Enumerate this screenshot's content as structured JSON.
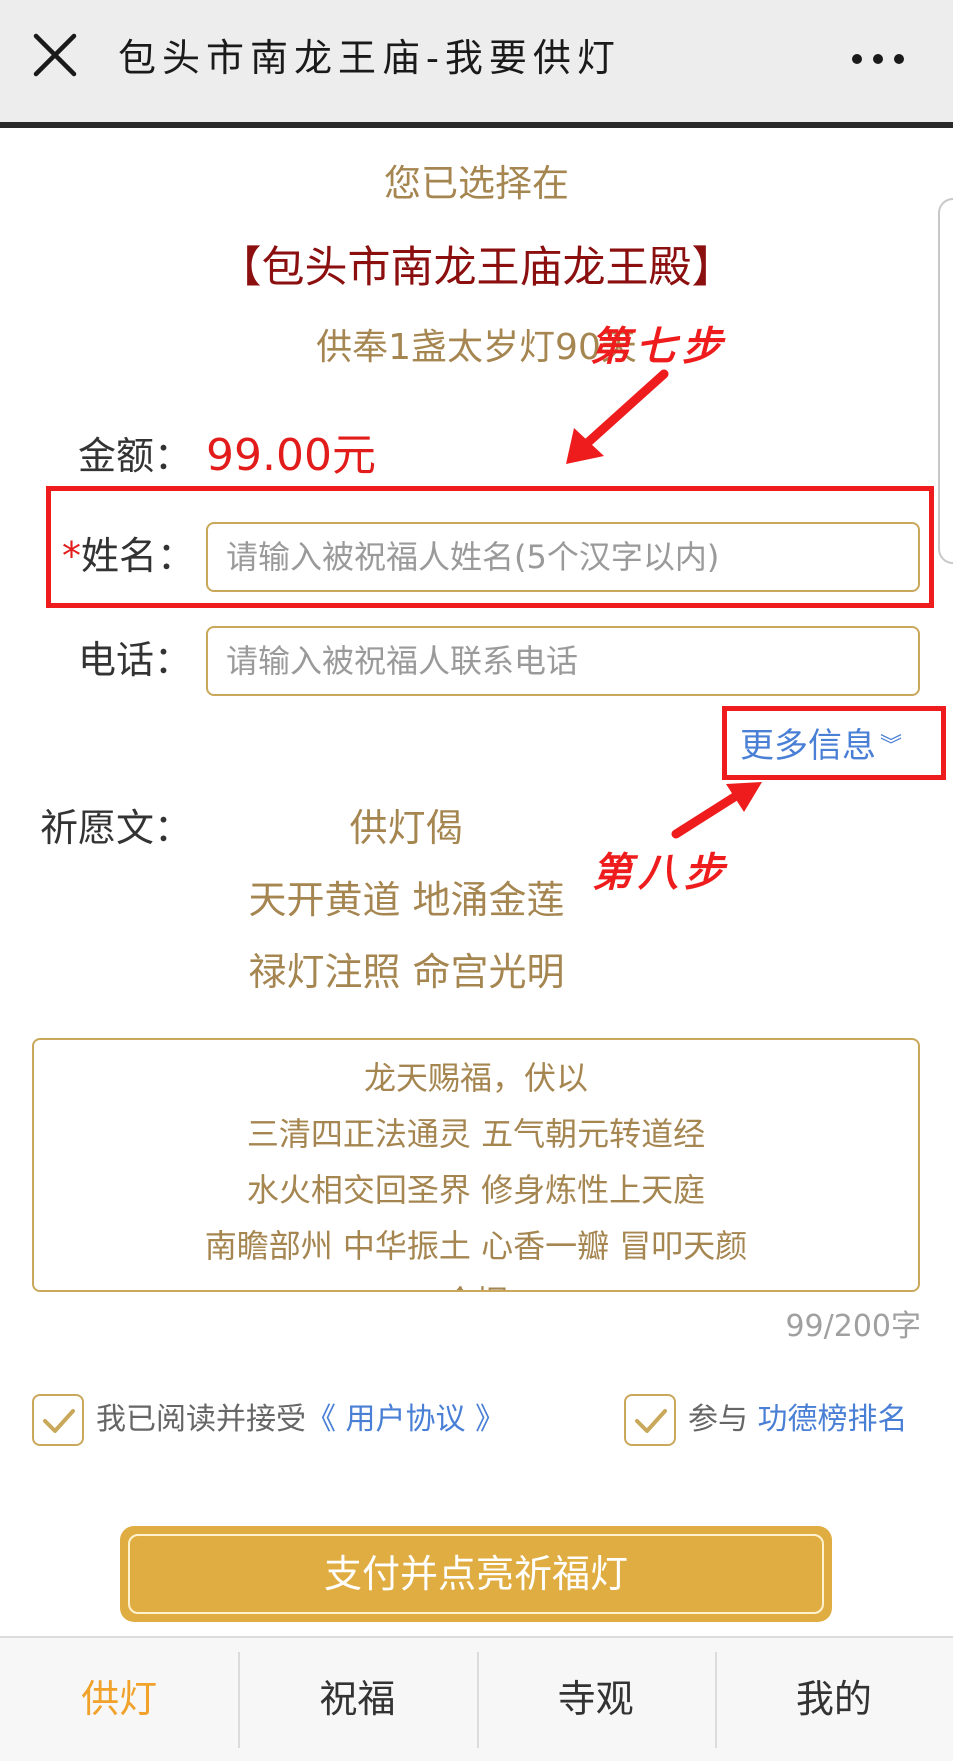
{
  "header": {
    "title": "包头市南龙王庙-我要供灯",
    "close_icon": "close-icon",
    "more_icon": "more-dots-icon"
  },
  "selection": {
    "prefix": "您已选择在",
    "temple": "【包头市南龙王庙龙王殿】",
    "lamp": "供奉1盏太岁灯90天"
  },
  "form": {
    "amount_label": "金额：",
    "amount_value": "99.00元",
    "name_required_mark": "*",
    "name_label": "姓名：",
    "name_placeholder": "请输入被祝福人姓名(5个汉字以内)",
    "phone_label": "电话：",
    "phone_placeholder": "请输入被祝福人联系电话",
    "more_info": "更多信息",
    "more_info_icon": "double-chevron-down-icon"
  },
  "annotations": {
    "step7": "第七步",
    "step8": "第八步",
    "color": "#ee1c1c"
  },
  "prayer": {
    "label": "祈愿文：",
    "title": "供灯偈",
    "verse1": "天开黄道 地涌金莲",
    "verse2": "禄灯注照 命宫光明",
    "text_lines": [
      "龙天赐福，伏以",
      "三清四正法通灵  五气朝元转道经",
      "水火相交回圣界  修身炼性上天庭",
      "南瞻部州  中华振土  心香一瓣  冒叩天颜",
      "今据"
    ],
    "counter": "99/200字"
  },
  "agreements": {
    "agree_prefix": "我已阅读并接受",
    "agree_link": "《 用户协议 》",
    "rank_prefix": "参与 ",
    "rank_link": "功德榜排名",
    "agree_checked": true,
    "rank_checked": true
  },
  "pay_button": "支付并点亮祈福灯",
  "tabs": [
    {
      "label": "供灯",
      "active": true
    },
    {
      "label": "祝福",
      "active": false
    },
    {
      "label": "寺观",
      "active": false
    },
    {
      "label": "我的",
      "active": false
    }
  ],
  "colors": {
    "accent_gold": "#e0ad42",
    "text_gold": "#a58550",
    "temple_red": "#8b0f0f",
    "price_red": "#e21b1b",
    "link_blue": "#4a7fd6",
    "tab_active": "#f0a22a"
  }
}
